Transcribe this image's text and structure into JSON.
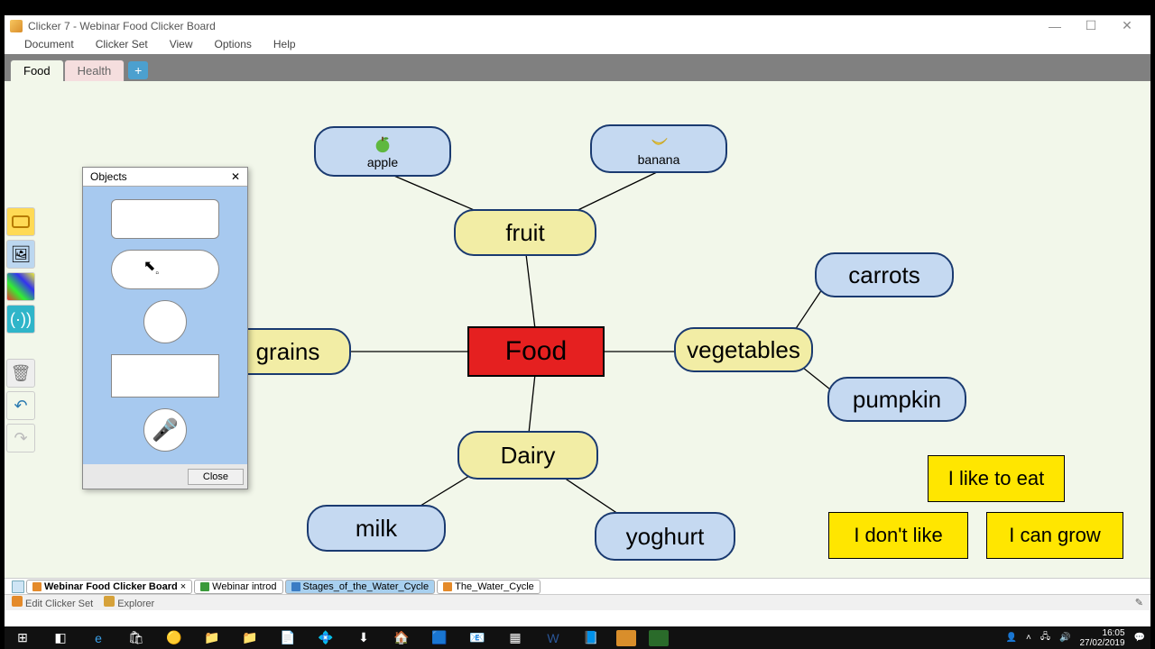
{
  "window": {
    "title": "Clicker 7 - Webinar Food Clicker Board",
    "min": "—",
    "max": "☐",
    "close": "✕"
  },
  "menu": {
    "document": "Document",
    "clickerset": "Clicker Set",
    "view": "View",
    "options": "Options",
    "help": "Help"
  },
  "tabs": {
    "food": "Food",
    "health": "Health",
    "add": "+"
  },
  "nodes": {
    "apple": "apple",
    "banana": "banana",
    "fruit": "fruit",
    "food": "Food",
    "grains": "grains",
    "vegetables": "vegetables",
    "carrots": "carrots",
    "pumpkin": "pumpkin",
    "dairy": "Dairy",
    "milk": "milk",
    "yoghurt": "yoghurt"
  },
  "sentences": {
    "like": "I like to eat",
    "dontlike": "I don't like",
    "grow": "I can grow"
  },
  "objects_panel": {
    "title": "Objects",
    "close_x": "✕",
    "close_btn": "Close"
  },
  "doc_tabs": {
    "t1": "Webinar Food Clicker Board",
    "t2": "Webinar introd",
    "t3": "Stages_of_the_Water_Cycle",
    "t4": "The_Water_Cycle"
  },
  "status": {
    "edit": "Edit Clicker Set",
    "explorer": "Explorer"
  },
  "taskbar": {
    "time": "16:05",
    "date": "27/02/2019"
  },
  "tools": {
    "sound_label": "(·))"
  }
}
